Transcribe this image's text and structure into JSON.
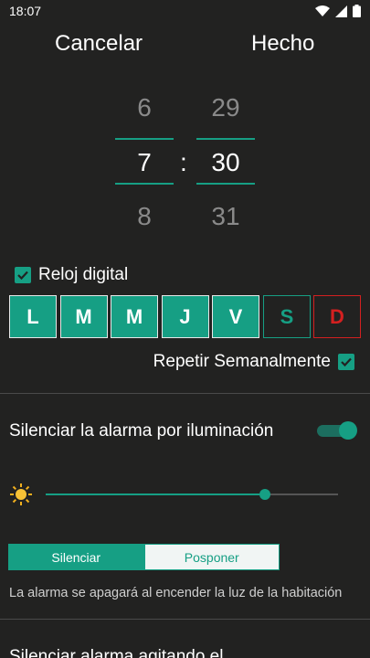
{
  "status_bar": {
    "time": "18:07"
  },
  "header": {
    "cancel_label": "Cancelar",
    "done_label": "Hecho"
  },
  "time_picker": {
    "hour_prev": "6",
    "hour": "7",
    "hour_next": "8",
    "minute_prev": "29",
    "minute": "30",
    "minute_next": "31",
    "separator": ":"
  },
  "digital_clock": {
    "label": "Reloj digital",
    "checked": true
  },
  "days": [
    {
      "label": "L",
      "selected": true
    },
    {
      "label": "M",
      "selected": true
    },
    {
      "label": "M",
      "selected": true
    },
    {
      "label": "J",
      "selected": true
    },
    {
      "label": "V",
      "selected": true
    },
    {
      "label": "S",
      "selected": false
    },
    {
      "label": "D",
      "selected": false
    }
  ],
  "repeat": {
    "label": "Repetir Semanalmente",
    "checked": true
  },
  "light_silence": {
    "title": "Silenciar la alarma por iluminación",
    "enabled": true,
    "sensitivity_level": 0.75,
    "mode_silence_label": "Silenciar",
    "mode_snooze_label": "Posponer",
    "selected_mode": "Silenciar",
    "info": "La alarma se apagará al encender la luz de la habitación"
  },
  "shake_silence": {
    "title": "Silenciar alarma agitando el"
  },
  "colors": {
    "accent": "#169f84",
    "background": "#222221",
    "sunday": "#d32020"
  }
}
